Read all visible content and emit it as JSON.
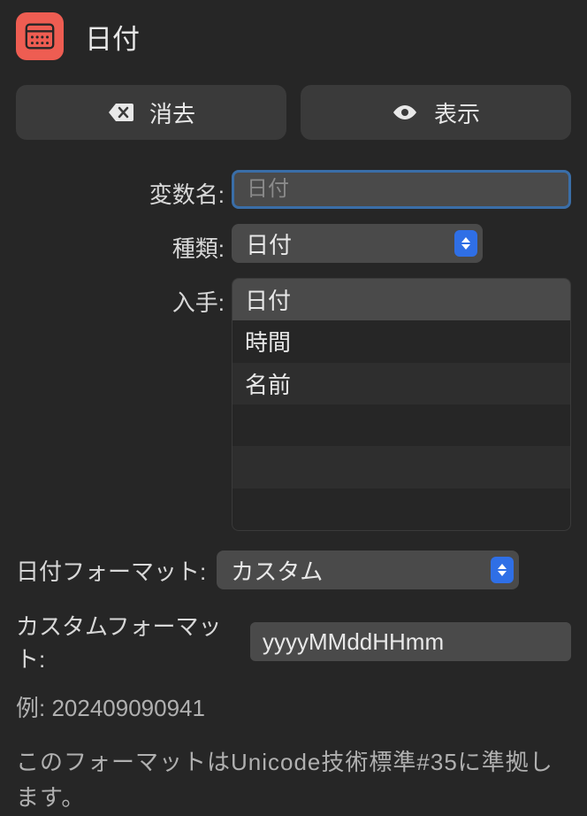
{
  "header": {
    "title": "日付"
  },
  "buttons": {
    "erase": "消去",
    "show": "表示"
  },
  "labels": {
    "var_name": "変数名:",
    "type": "種類:",
    "source": "入手:",
    "date_format": "日付フォーマット:",
    "custom_format": "カスタムフォーマット:"
  },
  "inputs": {
    "var_placeholder": "日付",
    "type_selected": "日付",
    "format_selected": "カスタム",
    "custom_value": "yyyyMMddHHmm"
  },
  "source_options": [
    "日付",
    "時間",
    "名前"
  ],
  "example": "例: 202409090941",
  "note": "このフォーマットはUnicode技術標準#35に準拠します。"
}
